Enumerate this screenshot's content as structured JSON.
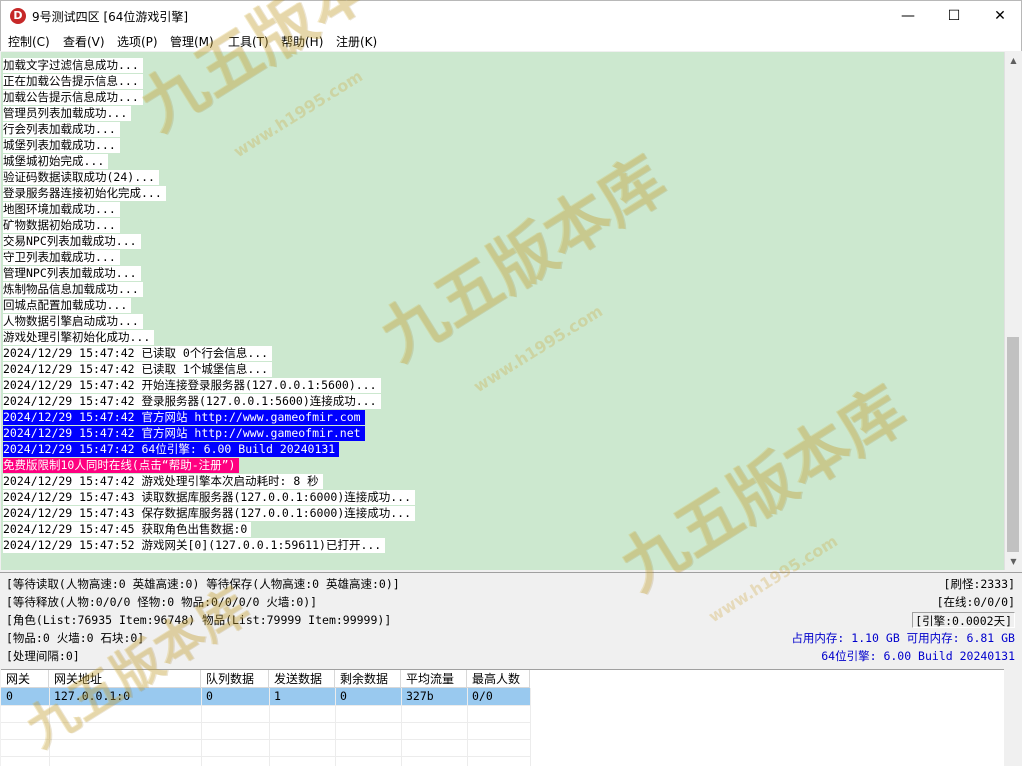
{
  "window": {
    "title": "9号测试四区 [64位游戏引擎]",
    "icon_letter": "D",
    "controls": {
      "minimize": "—",
      "maximize": "☐",
      "close": "✕"
    }
  },
  "menu": [
    {
      "label": "控制(C)"
    },
    {
      "label": "查看(V)"
    },
    {
      "label": "选项(P)"
    },
    {
      "label": "管理(M)"
    },
    {
      "label": "工具(T)"
    },
    {
      "label": "帮助(H)"
    },
    {
      "label": "注册(K)"
    }
  ],
  "log": [
    {
      "text": "加载文字过滤信息成功...",
      "style": "normal"
    },
    {
      "text": "正在加载公告提示信息...",
      "style": "normal"
    },
    {
      "text": "加载公告提示信息成功...",
      "style": "normal"
    },
    {
      "text": "管理员列表加载成功...",
      "style": "normal"
    },
    {
      "text": "行会列表加载成功...",
      "style": "normal"
    },
    {
      "text": "城堡列表加载成功...",
      "style": "normal"
    },
    {
      "text": "城堡城初始完成...",
      "style": "normal"
    },
    {
      "text": "验证码数据读取成功(24)...",
      "style": "normal"
    },
    {
      "text": "登录服务器连接初始化完成...",
      "style": "normal"
    },
    {
      "text": "地图环境加载成功...",
      "style": "normal"
    },
    {
      "text": "矿物数据初始成功...",
      "style": "normal"
    },
    {
      "text": "交易NPC列表加载成功...",
      "style": "normal"
    },
    {
      "text": "守卫列表加载成功...",
      "style": "normal"
    },
    {
      "text": "管理NPC列表加载成功...",
      "style": "normal"
    },
    {
      "text": "炼制物品信息加载成功...",
      "style": "normal"
    },
    {
      "text": "回城点配置加载成功...",
      "style": "normal"
    },
    {
      "text": "人物数据引擎启动成功...",
      "style": "normal"
    },
    {
      "text": "游戏处理引擎初始化成功...",
      "style": "normal"
    },
    {
      "text": "2024/12/29 15:47:42 已读取 0个行会信息...",
      "style": "normal"
    },
    {
      "text": "2024/12/29 15:47:42 已读取 1个城堡信息...",
      "style": "normal"
    },
    {
      "text": "2024/12/29 15:47:42 开始连接登录服务器(127.0.0.1:5600)...",
      "style": "normal"
    },
    {
      "text": "2024/12/29 15:47:42 登录服务器(127.0.0.1:5600)连接成功...",
      "style": "normal"
    },
    {
      "text": "2024/12/29 15:47:42 官方网站 http://www.gameofmir.com",
      "style": "blue"
    },
    {
      "text": "2024/12/29 15:47:42 官方网站 http://www.gameofmir.net",
      "style": "blue"
    },
    {
      "text": "2024/12/29 15:47:42 64位引擎: 6.00 Build 20240131",
      "style": "blue"
    },
    {
      "text": "免费版限制10人同时在线(点击“帮助-注册”)",
      "style": "magenta"
    },
    {
      "text": "2024/12/29 15:47:42 游戏处理引擎本次启动耗时: 8 秒",
      "style": "normal"
    },
    {
      "text": "2024/12/29 15:47:43 读取数据库服务器(127.0.0.1:6000)连接成功...",
      "style": "normal"
    },
    {
      "text": "2024/12/29 15:47:43 保存数据库服务器(127.0.0.1:6000)连接成功...",
      "style": "normal"
    },
    {
      "text": "2024/12/29 15:47:45 获取角色出售数据:0",
      "style": "normal"
    },
    {
      "text": "2024/12/29 15:47:52 游戏网关[0](127.0.0.1:59611)已打开...",
      "style": "normal"
    }
  ],
  "status": {
    "left": [
      "[等待读取(人物高速:0 英雄高速:0) 等待保存(人物高速:0 英雄高速:0)]",
      "[等待释放(人物:0/0/0 怪物:0 物品:0/0/0/0 火墙:0)]",
      "[角色(List:76935 Item:96748) 物品(List:79999 Item:99999)]",
      "[物品:0 火墙:0 石块:0]",
      "[处理间隔:0]"
    ],
    "refresh": "[刷怪:2333]",
    "online": "[在线:0/0/0]",
    "engine_time": "[引擎:0.0002天]",
    "memory": "占用内存: 1.10 GB 可用内存: 6.81 GB",
    "build": "64位引擎: 6.00 Build 20240131"
  },
  "gateway": {
    "headers": [
      "网关",
      "网关地址",
      "队列数据",
      "发送数据",
      "剩余数据",
      "平均流量",
      "最高人数"
    ],
    "rows": [
      [
        "0",
        "127.0.0.1:0",
        "0",
        "1",
        "0",
        "327b",
        "0/0"
      ]
    ]
  },
  "watermark": {
    "text": "九五版本库",
    "url": "www.h1995.com"
  },
  "colors": {
    "log_background": "#cce8cf",
    "highlight_blue": "#0000ff",
    "highlight_magenta": "#ff0080",
    "selected_row": "#99c9ef"
  }
}
